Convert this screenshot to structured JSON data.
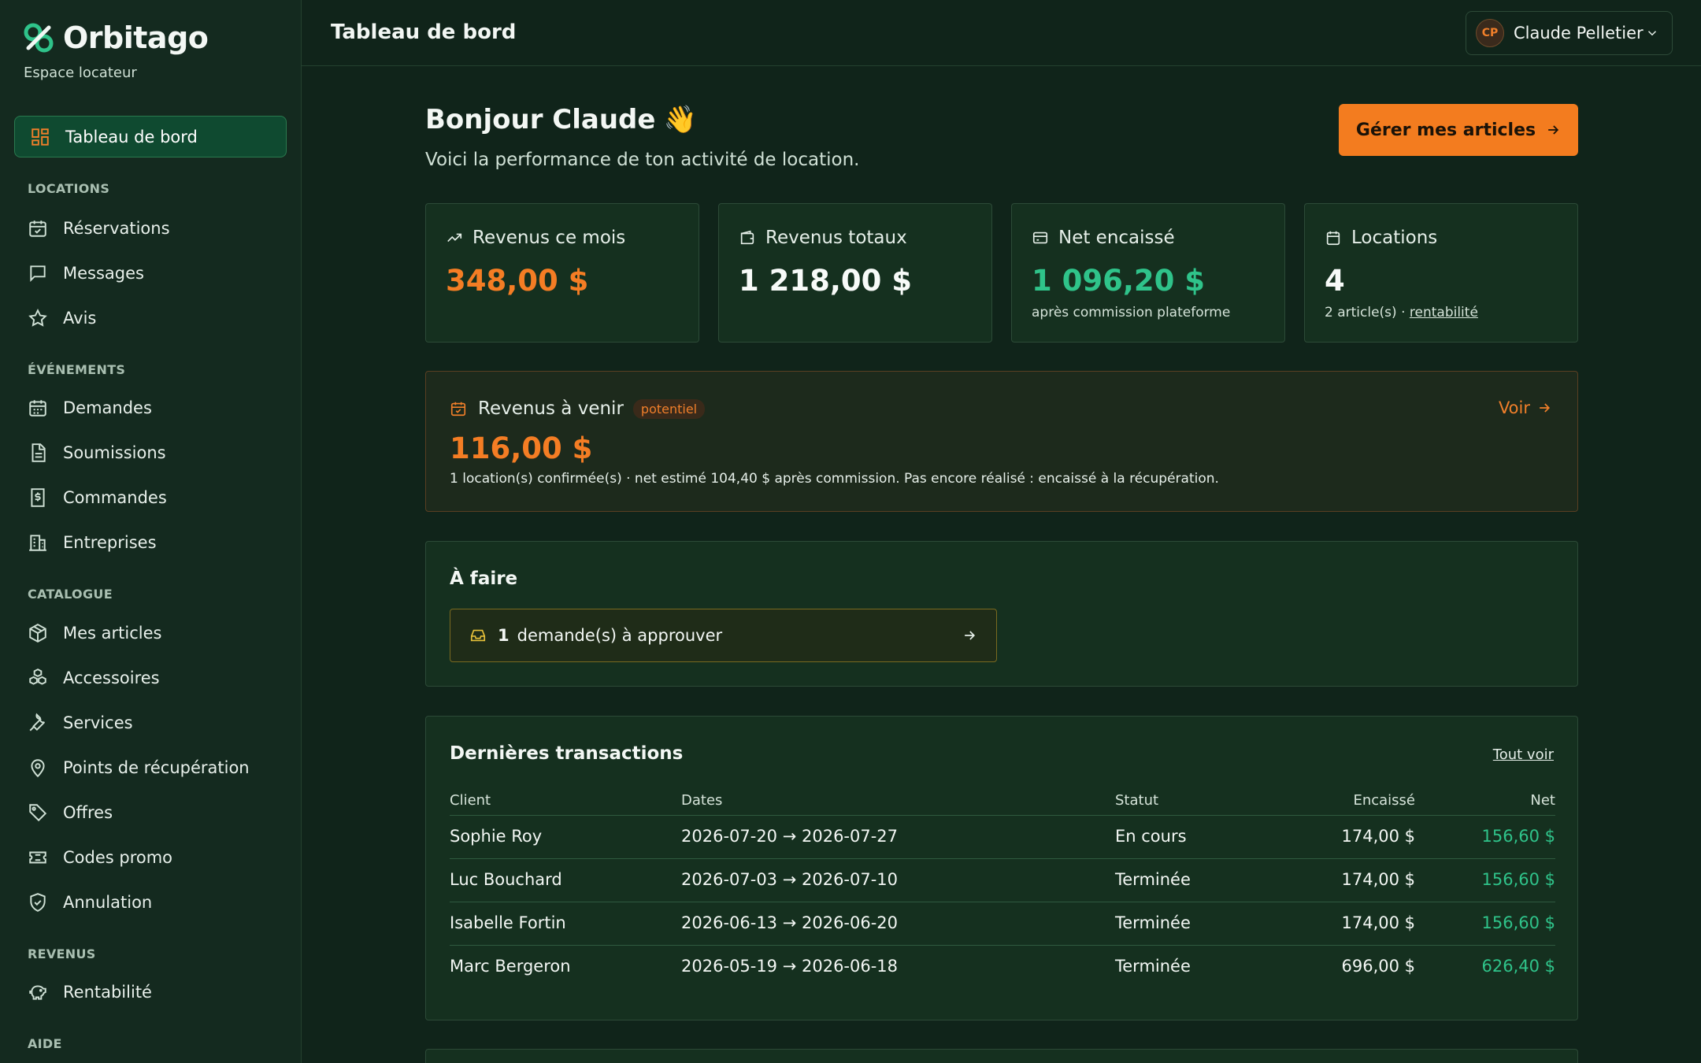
{
  "brand": {
    "name": "Orbitago",
    "subtitle": "Espace locateur"
  },
  "sidebar": {
    "active": {
      "label": "Tableau de bord",
      "icon": "dashboard-icon"
    },
    "sections": [
      {
        "title": "LOCATIONS",
        "items": [
          {
            "label": "Réservations",
            "icon": "calendar-check-icon"
          },
          {
            "label": "Messages",
            "icon": "message-icon"
          },
          {
            "label": "Avis",
            "icon": "star-icon"
          }
        ]
      },
      {
        "title": "ÉVÉNEMENTS",
        "items": [
          {
            "label": "Demandes",
            "icon": "calendar-list-icon"
          },
          {
            "label": "Soumissions",
            "icon": "document-icon"
          },
          {
            "label": "Commandes",
            "icon": "dollar-receipt-icon"
          },
          {
            "label": "Entreprises",
            "icon": "building-icon"
          }
        ]
      },
      {
        "title": "CATALOGUE",
        "items": [
          {
            "label": "Mes articles",
            "icon": "box-icon"
          },
          {
            "label": "Accessoires",
            "icon": "boxes-icon"
          },
          {
            "label": "Services",
            "icon": "wrench-icon"
          },
          {
            "label": "Points de récupération",
            "icon": "map-pin-icon"
          },
          {
            "label": "Offres",
            "icon": "tag-icon"
          },
          {
            "label": "Codes promo",
            "icon": "ticket-icon"
          },
          {
            "label": "Annulation",
            "icon": "shield-check-icon"
          }
        ]
      },
      {
        "title": "REVENUS",
        "items": [
          {
            "label": "Rentabilité",
            "icon": "piggy-bank-icon"
          }
        ]
      },
      {
        "title": "AIDE",
        "items": []
      }
    ]
  },
  "header": {
    "title": "Tableau de bord",
    "user_initials": "CP",
    "user_name": "Claude Pelletier"
  },
  "main": {
    "greeting": "Bonjour Claude",
    "wave": "👋",
    "subtitle": "Voici la performance de ton activité de location.",
    "cta_label": "Gérer mes articles",
    "stats": [
      {
        "title": "Revenus ce mois",
        "value": "348,00 $",
        "note": "",
        "color": "#f47d24",
        "icon": "trending-up-icon"
      },
      {
        "title": "Revenus totaux",
        "value": "1 218,00 $",
        "note": "",
        "color": "#f7faf8",
        "icon": "wallet-icon"
      },
      {
        "title": "Net encaissé",
        "value": "1 096,20 $",
        "note": "après commission plateforme",
        "color": "#2fc38a",
        "icon": "credit-card-icon"
      },
      {
        "title": "Locations",
        "value": "4",
        "note": "2 article(s) · ",
        "note_link": "rentabilité",
        "color": "#f7faf8",
        "icon": "calendar-icon"
      }
    ],
    "upcoming": {
      "title": "Revenus à venir",
      "badge": "potentiel",
      "value": "116,00 $",
      "note": "1 location(s) confirmée(s) · net estimé 104,40 $ après commission. Pas encore réalisé : encaissé à la récupération.",
      "link": "Voir"
    },
    "todo": {
      "title": "À faire",
      "item_count": "1",
      "item_label": "demande(s) à approuver"
    },
    "transactions": {
      "title": "Dernières transactions",
      "see_all": "Tout voir",
      "columns": [
        "Client",
        "Dates",
        "Statut",
        "Encaissé",
        "Net"
      ],
      "rows": [
        {
          "client": "Sophie Roy",
          "dates": "2026-07-20 → 2026-07-27",
          "status": "En cours",
          "collected": "174,00 $",
          "net": "156,60 $"
        },
        {
          "client": "Luc Bouchard",
          "dates": "2026-07-03 → 2026-07-10",
          "status": "Terminée",
          "collected": "174,00 $",
          "net": "156,60 $"
        },
        {
          "client": "Isabelle Fortin",
          "dates": "2026-06-13 → 2026-06-20",
          "status": "Terminée",
          "collected": "174,00 $",
          "net": "156,60 $"
        },
        {
          "client": "Marc Bergeron",
          "dates": "2026-05-19 → 2026-06-18",
          "status": "Terminée",
          "collected": "696,00 $",
          "net": "626,40 $"
        }
      ]
    }
  },
  "colors": {
    "accent": "#f37c1f",
    "positive": "#2fc38a",
    "background": "#10241a",
    "sidebar": "#142a1f"
  }
}
